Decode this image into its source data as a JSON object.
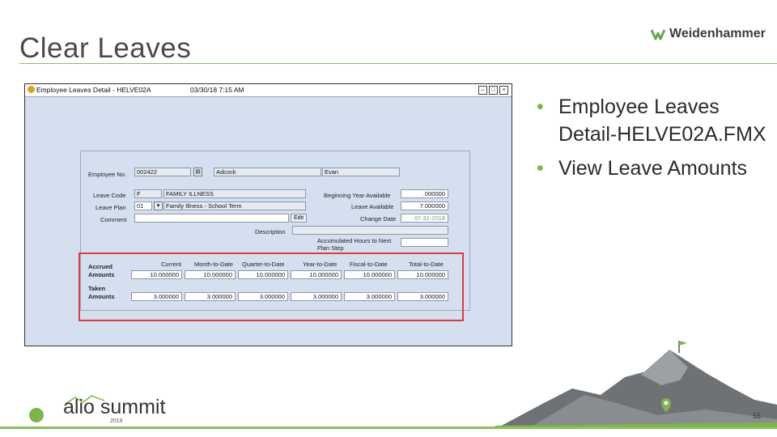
{
  "slide": {
    "title": "Clear Leaves",
    "brand": "Weidenhammer",
    "page_number": "55",
    "footer_logo": "alio summit",
    "footer_year": "2019"
  },
  "bullets": [
    "Employee Leaves Detail-HELVE02A.FMX",
    "View Leave Amounts"
  ],
  "window": {
    "title": "Employee Leaves Detail - HELVE02A",
    "datetime": "03/30/18  7:15 AM"
  },
  "form": {
    "employee_no_label": "Employee No.",
    "employee_no": "002422",
    "last_name": "Adcock",
    "first_name": "Evan",
    "leave_code_label": "Leave Code",
    "leave_code": "F",
    "leave_code_desc": "FAMILY ILLNESS",
    "leave_plan_label": "Leave Plan",
    "leave_plan": "01",
    "leave_plan_desc": "Family Illness - School Term",
    "comment_label": "Comment",
    "edit_label": "Edit",
    "description_label": "Description",
    "beginning_year_label": "Beginning Year Available",
    "beginning_year_value": ".000000",
    "leave_available_label": "Leave Available",
    "leave_available_value": "7.000000",
    "change_date_label": "Change Date",
    "change_date_value": "07-31-2018",
    "accum_hours_label": "Accumulated Hours to Next Plan Step",
    "columns": [
      "Current",
      "Month-to-Date",
      "Quarter-to-Date",
      "Year-to-Date",
      "Fiscal-to-Date",
      "Total-to-Date"
    ],
    "accrued_label": "Accrued Amounts",
    "accrued": [
      "10.000000",
      "10.000000",
      "10.000000",
      "10.000000",
      "10.000000",
      "10.000000"
    ],
    "taken_label": "Taken Amounts",
    "taken": [
      "3.000000",
      "3.000000",
      "3.000000",
      "3.000000",
      "3.000000",
      "3.000000"
    ]
  },
  "colors": {
    "accent_green": "#8bbf5c",
    "highlight_red": "#e0393e",
    "form_bg": "#d4e0ef"
  }
}
